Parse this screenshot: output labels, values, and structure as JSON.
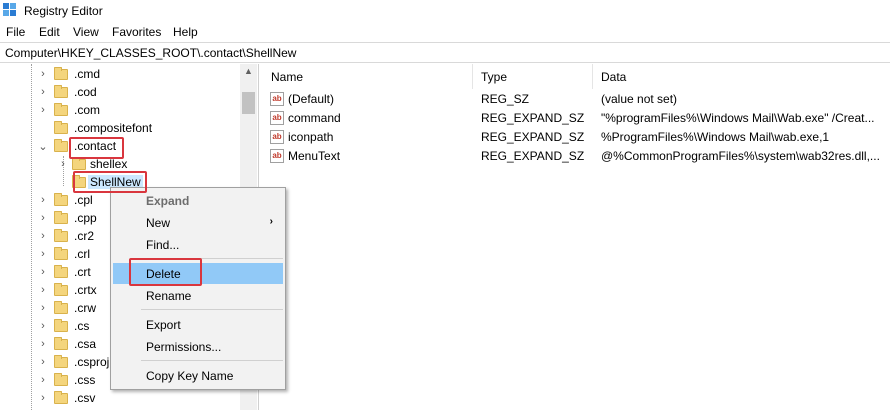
{
  "window": {
    "title": "Registry Editor",
    "icon": "registry-icon"
  },
  "menu": [
    "File",
    "Edit",
    "View",
    "Favorites",
    "Help"
  ],
  "address": "Computer\\HKEY_CLASSES_ROOT\\.contact\\ShellNew",
  "tree": [
    {
      "label": ".cmd",
      "expander": "collapsed"
    },
    {
      "label": ".cod",
      "expander": "collapsed"
    },
    {
      "label": ".com",
      "expander": "collapsed"
    },
    {
      "label": ".compositefont",
      "expander": "none"
    },
    {
      "label": ".contact",
      "expander": "expanded"
    },
    {
      "label": "shellex",
      "expander": "collapsed"
    },
    {
      "label": "ShellNew",
      "expander": "none",
      "selected": true
    },
    {
      "label": ".cpl",
      "expander": "collapsed"
    },
    {
      "label": ".cpp",
      "expander": "collapsed"
    },
    {
      "label": ".cr2",
      "expander": "collapsed"
    },
    {
      "label": ".crl",
      "expander": "collapsed"
    },
    {
      "label": ".crt",
      "expander": "collapsed"
    },
    {
      "label": ".crtx",
      "expander": "collapsed"
    },
    {
      "label": ".crw",
      "expander": "collapsed"
    },
    {
      "label": ".cs",
      "expander": "collapsed"
    },
    {
      "label": ".csa",
      "expander": "collapsed"
    },
    {
      "label": ".csproj",
      "expander": "collapsed"
    },
    {
      "label": ".css",
      "expander": "collapsed"
    },
    {
      "label": ".csv",
      "expander": "collapsed"
    }
  ],
  "columns": [
    "Name",
    "Type",
    "Data"
  ],
  "values": [
    {
      "name": "(Default)",
      "type": "REG_SZ",
      "data": "(value not set)"
    },
    {
      "name": "command",
      "type": "REG_EXPAND_SZ",
      "data": "\"%programFiles%\\Windows Mail\\Wab.exe\" /Creat..."
    },
    {
      "name": "iconpath",
      "type": "REG_EXPAND_SZ",
      "data": "%ProgramFiles%\\Windows Mail\\wab.exe,1"
    },
    {
      "name": "MenuText",
      "type": "REG_EXPAND_SZ",
      "data": "@%CommonProgramFiles%\\system\\wab32res.dll,..."
    }
  ],
  "context_menu": {
    "expand": "Expand",
    "new": "New",
    "find": "Find...",
    "delete": "Delete",
    "rename": "Rename",
    "export": "Export",
    "permissions": "Permissions...",
    "copy_key_name": "Copy Key Name"
  },
  "colors": {
    "annotation": "#d9363e",
    "selection": "#cce8ff",
    "menu_highlight": "#91c9f7"
  }
}
